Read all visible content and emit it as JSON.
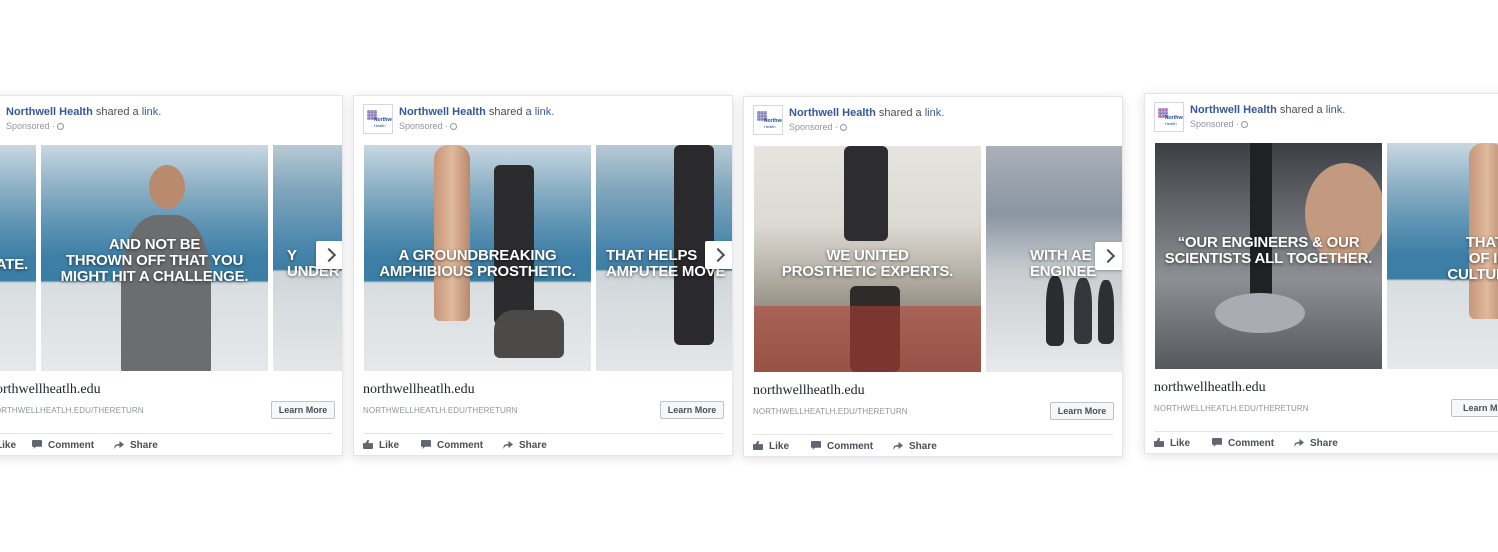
{
  "ads": [
    {
      "page_name": "Northwell Health",
      "shared_text": "shared a",
      "link_text": "link.",
      "sponsored": "Sponsored ·",
      "tiles": [
        {
          "caption": "ATE."
        },
        {
          "caption": "AND NOT BE\nTHROWN OFF THAT YOU\nMIGHT HIT A CHALLENGE."
        },
        {
          "caption": "Y\nUNDER"
        }
      ],
      "domain": "northwellheatlh.edu",
      "display_url": "NORTHWELLHEATLH.EDU/THERETURN",
      "cta": "Learn More",
      "actions": {
        "like": "Like",
        "comment": "Comment",
        "share": "Share"
      }
    },
    {
      "page_name": "Northwell Health",
      "shared_text": "shared a",
      "link_text": "link.",
      "sponsored": "Sponsored ·",
      "tiles": [
        {
          "caption": "A GROUNDBREAKING\nAMPHIBIOUS PROSTHETIC."
        },
        {
          "caption": "THAT HELPS\nAMPUTEE MOVE"
        }
      ],
      "domain": "northwellheatlh.edu",
      "display_url": "NORTHWELLHEATLH.EDU/THERETURN",
      "cta": "Learn More",
      "actions": {
        "like": "Like",
        "comment": "Comment",
        "share": "Share"
      }
    },
    {
      "page_name": "Northwell Health",
      "shared_text": "shared a",
      "link_text": "link.",
      "sponsored": "Sponsored ·",
      "tiles": [
        {
          "caption": "WE UNITED\nPROSTHETIC EXPERTS."
        },
        {
          "caption": "WITH AE\nENGINEE"
        }
      ],
      "domain": "northwellheatlh.edu",
      "display_url": "NORTHWELLHEATLH.EDU/THERETURN",
      "cta": "Learn More",
      "actions": {
        "like": "Like",
        "comment": "Comment",
        "share": "Share"
      }
    },
    {
      "page_name": "Northwell Health",
      "shared_text": "shared a",
      "link_text": "link.",
      "sponsored": "Sponsored ·",
      "tiles": [
        {
          "caption": "“OUR ENGINEERS & OUR\nSCIENTISTS ALL TOGETHER."
        },
        {
          "caption": "THAT'S T\nOF INNO\nCULTURE Y"
        }
      ],
      "domain": "northwellheatlh.edu",
      "display_url": "NORTHWELLHEATLH.EDU/THERETURN",
      "cta": "Learn Mo",
      "actions": {
        "like": "Like",
        "comment": "Comment",
        "share": "Share"
      }
    }
  ]
}
